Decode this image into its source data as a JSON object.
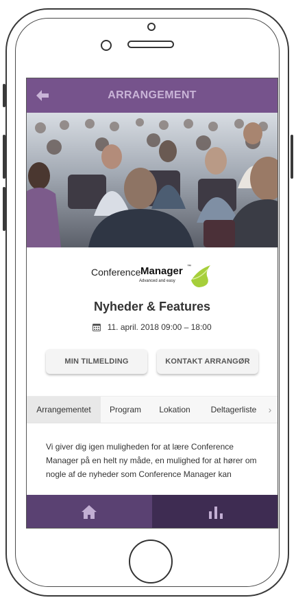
{
  "header": {
    "title": "ARRANGEMENT",
    "back_icon": "arrow-left-icon"
  },
  "hero": {
    "image": "conference-audience-photo"
  },
  "logo": {
    "brand_light": "Conference",
    "brand_bold": "Manager",
    "trademark": "™",
    "tagline": "Advanced and easy"
  },
  "event": {
    "title": "Nyheder & Features",
    "date": "11. april. 2018",
    "time": "09:00 – 18:00",
    "calendar_icon": "calendar-icon"
  },
  "actions": {
    "register_label": "MIN TILMELDING",
    "contact_label": "KONTAKT ARRANGØR"
  },
  "tabs": [
    {
      "label": "Arrangementet",
      "active": true
    },
    {
      "label": "Program",
      "active": false
    },
    {
      "label": "Lokation",
      "active": false
    },
    {
      "label": "Deltagerliste",
      "active": false
    }
  ],
  "tabs_more_icon": "chevron-right-icon",
  "description": "Vi giver dig igen muligheden for at lære Conference Manager på en helt ny måde, en mulighed for at hører om nogle af de nyheder som Conference Manager kan",
  "bottom_nav": {
    "home_icon": "home-icon",
    "stats_icon": "bar-chart-icon"
  },
  "colors": {
    "header_bg": "#76538c",
    "nav_left": "#5a4172",
    "nav_right": "#3e2c52",
    "logo_accent": "#a6cf3a"
  }
}
